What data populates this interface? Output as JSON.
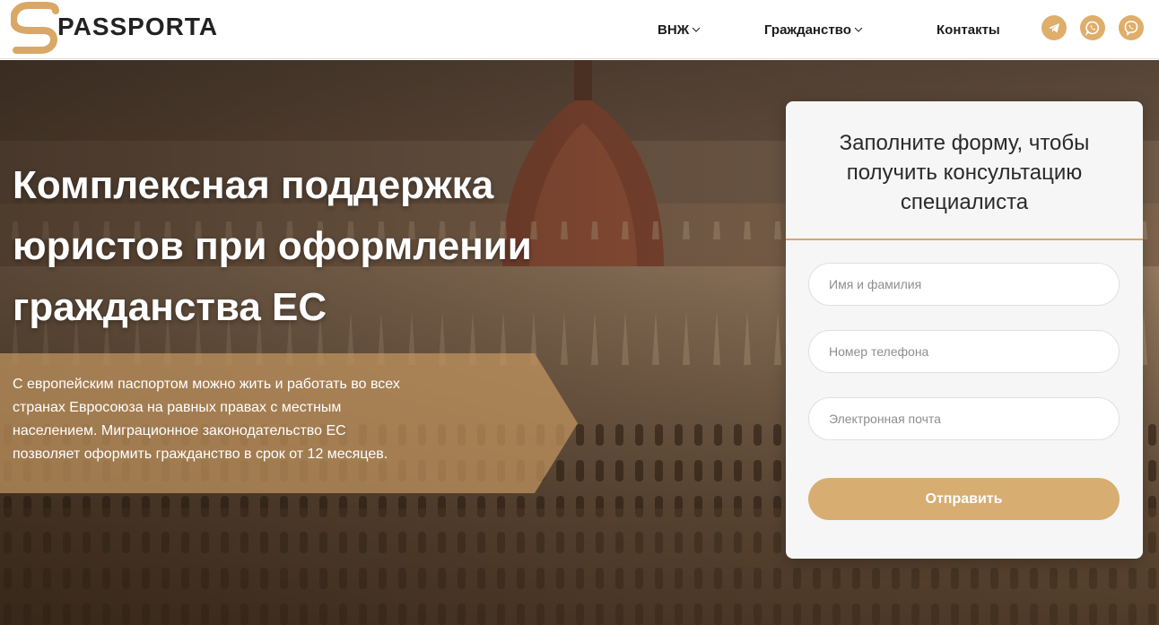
{
  "header": {
    "brand": "PASSPORTA",
    "nav": [
      {
        "label": "ВНЖ",
        "has_dropdown": true
      },
      {
        "label": "Гражданство",
        "has_dropdown": true
      },
      {
        "label": "Контакты",
        "has_dropdown": false
      }
    ],
    "social": [
      {
        "icon": "telegram-icon"
      },
      {
        "icon": "whatsapp-icon"
      },
      {
        "icon": "viber-icon"
      }
    ]
  },
  "hero": {
    "title_lines": [
      "Комплексная поддержка",
      "юристов при оформлении",
      "гражданства ЕС"
    ],
    "text_lines": [
      "С европейским паспортом можно жить и работать во всех",
      "странах Евросоюза на равных правах с местным",
      "населением. Миграционное законодательство ЕС",
      "позволяет оформить гражданство в срок от 12 месяцев."
    ]
  },
  "form": {
    "title_lines": [
      "Заполните форму, чтобы",
      "получить консультацию",
      "специалиста"
    ],
    "name_placeholder": "Имя и фамилия",
    "phone_placeholder": "Номер телефона",
    "email_placeholder": "Электронная почта",
    "submit_label": "Отправить"
  },
  "colors": {
    "accent": "#d8ad72",
    "logo_gold": "#d9a866",
    "social_bg": "#deae6a",
    "text_dark": "#222222"
  }
}
